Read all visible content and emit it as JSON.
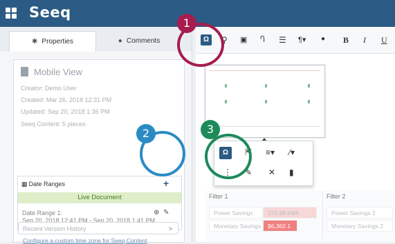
{
  "app": {
    "name": "Seeq"
  },
  "tabs": [
    {
      "label": "Properties",
      "icon": "gear-icon"
    },
    {
      "label": "Comments",
      "icon": "comment-icon"
    }
  ],
  "document": {
    "title": "Mobile View",
    "creator": "Creator: Demo User",
    "created": "Created: Mar 26, 2018 12:31 PM",
    "updated": "Updated: Sep 20, 2018 1:36 PM",
    "seeq_content": "Seeq Content: 5 pieces"
  },
  "date_ranges": {
    "header": "Date Ranges",
    "add_label": "+",
    "live_label": "Live Document",
    "range_name": "Date Range 1:",
    "range_value": "Sep 20, 2018 12:41 PM - Sep 20, 2018 1:41 PM",
    "timezone_link": "Configure a custom time zone for Seeq Content"
  },
  "recent_versions": {
    "label": "Recent Version History",
    "chevron": ">"
  },
  "toolbar": {
    "items": [
      "seeq-logo-icon",
      "link-icon",
      "image-icon",
      "heading-icon",
      "horizontal-rule-icon",
      "paragraph-icon",
      "ink-icon",
      "bold-icon",
      "italic-icon",
      "underline-icon"
    ],
    "bold_label": "B",
    "italic_label": "I",
    "underline_label": "U",
    "paragraph_label": "¶▾"
  },
  "popover": {
    "items": [
      "seeq-logo-icon",
      "external-link-icon",
      "align-dropdown-icon",
      "magic-wand-icon",
      "more-icon",
      "edit-icon",
      "expand-icon",
      "delete-icon"
    ]
  },
  "filters": [
    {
      "header": "Filter 1",
      "rows": [
        {
          "label": "Power Savings",
          "value": "373.98 kWh"
        },
        {
          "label": "Monetary Savings",
          "value": "$6,362.1"
        }
      ]
    },
    {
      "header": "Filter 2",
      "rows": [
        {
          "label": "Power Savings 2",
          "value": ""
        },
        {
          "label": "Monetary Savings 2",
          "value": ""
        }
      ]
    }
  ],
  "annotations": [
    {
      "number": "1",
      "color": "#a61c4e"
    },
    {
      "number": "2",
      "color": "#2a8bc4"
    },
    {
      "number": "3",
      "color": "#1d8a5a"
    }
  ]
}
